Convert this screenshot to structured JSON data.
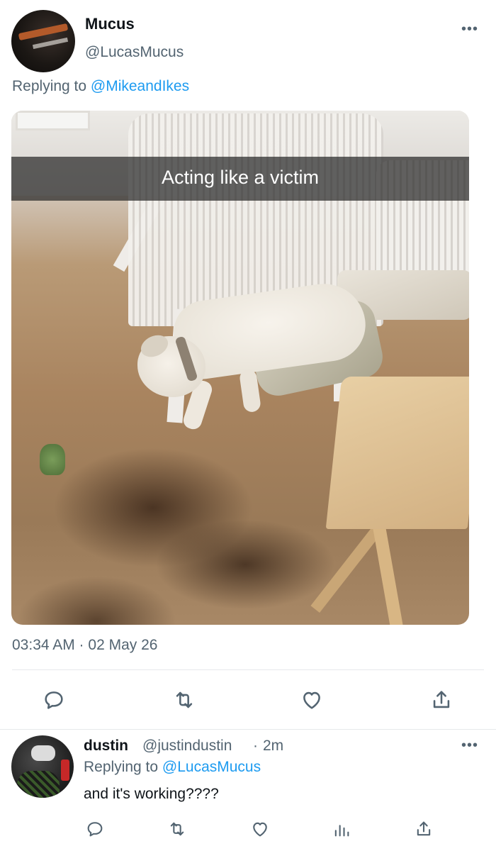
{
  "main_tweet": {
    "display_name": "Mucus",
    "handle": "@LucasMucus",
    "replying_prefix": "Replying to",
    "replying_to": "@MikeandIkes",
    "image_caption": "Acting like a victim",
    "timestamp": "03:34 AM · 02 May 26",
    "more_glyph": "•••",
    "actions": [
      "reply-icon",
      "retweet-icon",
      "like-icon",
      "share-icon"
    ]
  },
  "reply_tweet": {
    "display_name": "dustin",
    "handle": "@justindustin",
    "separator": "·",
    "relative_time": "2m",
    "replying_prefix": "Replying to",
    "replying_to": "@LucasMucus",
    "text": "and it's working????",
    "more_glyph": "•••",
    "actions": [
      "reply-icon",
      "retweet-icon",
      "like-icon",
      "analytics-icon",
      "share-icon"
    ]
  },
  "colors": {
    "accent": "#1d9bf0",
    "secondary_text": "#536471",
    "primary_text": "#0f1419",
    "divider": "#e6e9eb"
  }
}
